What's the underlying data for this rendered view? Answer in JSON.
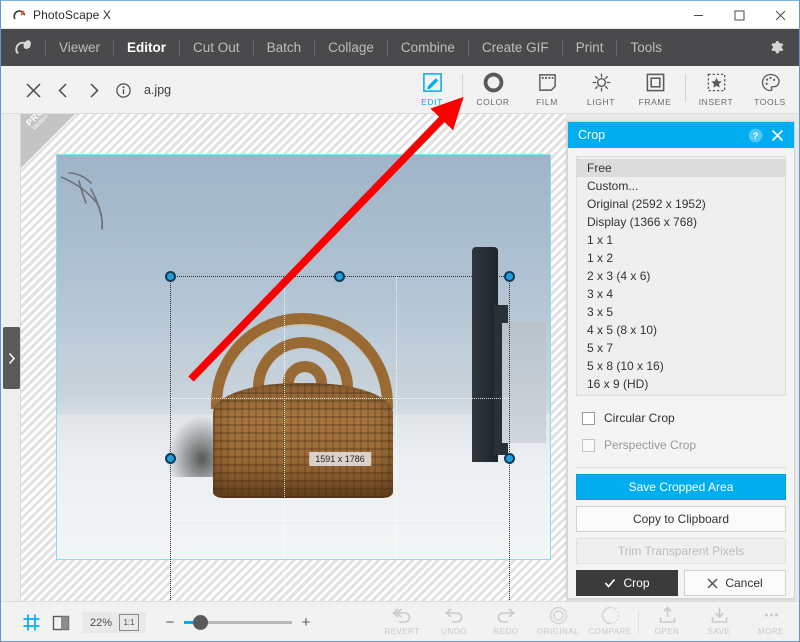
{
  "window": {
    "title": "PhotoScape X",
    "logo_icon": "photoscape-logo-icon",
    "minimize_label": "–",
    "maximize_label": "□",
    "close_label": "✕"
  },
  "menubar": {
    "logo_icon": "app-mark-icon",
    "items": [
      {
        "label": "Viewer",
        "active": false
      },
      {
        "label": "Editor",
        "active": true
      },
      {
        "label": "Cut Out",
        "active": false
      },
      {
        "label": "Batch",
        "active": false
      },
      {
        "label": "Collage",
        "active": false
      },
      {
        "label": "Combine",
        "active": false
      },
      {
        "label": "Create GIF",
        "active": false
      },
      {
        "label": "Print",
        "active": false
      },
      {
        "label": "Tools",
        "active": false
      }
    ],
    "settings_icon": "gear-icon"
  },
  "subtoolbar": {
    "close_icon": "close-x-icon",
    "prev_icon": "chevron-left-icon",
    "next_icon": "chevron-right-icon",
    "info_icon": "info-circle-icon",
    "file_name": "a.jpg",
    "tools": [
      {
        "label": "EDIT",
        "icon": "pencil-square-icon",
        "active": true
      },
      {
        "label": "COLOR",
        "icon": "color-ring-icon",
        "active": false
      },
      {
        "label": "FILM",
        "icon": "film-strip-icon",
        "active": false
      },
      {
        "label": "LIGHT",
        "icon": "sun-icon",
        "active": false
      },
      {
        "label": "FRAME",
        "icon": "frame-square-icon",
        "active": false
      },
      {
        "label": "INSERT",
        "icon": "star-dashed-icon",
        "active": false
      },
      {
        "label": "TOOLS",
        "icon": "palette-brush-icon",
        "active": false
      }
    ]
  },
  "canvas": {
    "rail_handle_icon": "chevron-right-icon",
    "pro_badge": "PRO",
    "pro_badge_sub": "Version",
    "crop_dimensions": "1591 x 1786",
    "selection_handle_color": "#1f9fe0",
    "guide_color": "#7ce3ef",
    "annotation_arrow_color": "#fb0000"
  },
  "panel": {
    "title": "Crop",
    "help_icon": "question-circle-icon",
    "close_icon": "close-x-icon",
    "ratios": [
      {
        "label": "Free",
        "selected": true
      },
      {
        "label": "Custom...",
        "selected": false
      },
      {
        "label": "Original (2592 x 1952)",
        "selected": false
      },
      {
        "label": "Display (1366 x 768)",
        "selected": false
      },
      {
        "label": "1 x 1",
        "selected": false
      },
      {
        "label": "1 x 2",
        "selected": false
      },
      {
        "label": "2 x 3 (4 x 6)",
        "selected": false
      },
      {
        "label": "3 x 4",
        "selected": false
      },
      {
        "label": "3 x 5",
        "selected": false
      },
      {
        "label": "4 x 5 (8 x 10)",
        "selected": false
      },
      {
        "label": "5 x 7",
        "selected": false
      },
      {
        "label": "5 x 8 (10 x 16)",
        "selected": false
      },
      {
        "label": "16 x 9 (HD)",
        "selected": false
      }
    ],
    "checkboxes": [
      {
        "label": "Circular Crop",
        "checked": false,
        "disabled": false
      },
      {
        "label": "Perspective Crop",
        "checked": false,
        "disabled": true
      }
    ],
    "save_cropped_area": "Save Cropped Area",
    "copy_to_clipboard": "Copy to Clipboard",
    "trim_transparent_pixels": "Trim Transparent Pixels",
    "crop_button": "Crop",
    "crop_icon": "check-icon",
    "cancel_button": "Cancel",
    "cancel_icon": "close-x-icon",
    "accent_color": "#00aeef"
  },
  "bottombar": {
    "grid_icon": "grid-icon",
    "split_icon": "split-view-icon",
    "zoom_percent": "22%",
    "fit_label": "1:1",
    "zoom_out": "−",
    "zoom_in": "+",
    "tools": [
      {
        "label": "REVERT",
        "icon": "revert-arrow-icon"
      },
      {
        "label": "UNDO",
        "icon": "undo-arrow-icon"
      },
      {
        "label": "REDO",
        "icon": "redo-arrow-icon"
      },
      {
        "label": "ORIGINAL",
        "icon": "original-circle-icon"
      },
      {
        "label": "COMPARE",
        "icon": "compare-circle-icon"
      },
      {
        "label": "OPEN",
        "icon": "open-upload-icon"
      },
      {
        "label": "SAVE",
        "icon": "save-download-icon"
      },
      {
        "label": "MORE",
        "icon": "more-dots-icon"
      }
    ]
  }
}
